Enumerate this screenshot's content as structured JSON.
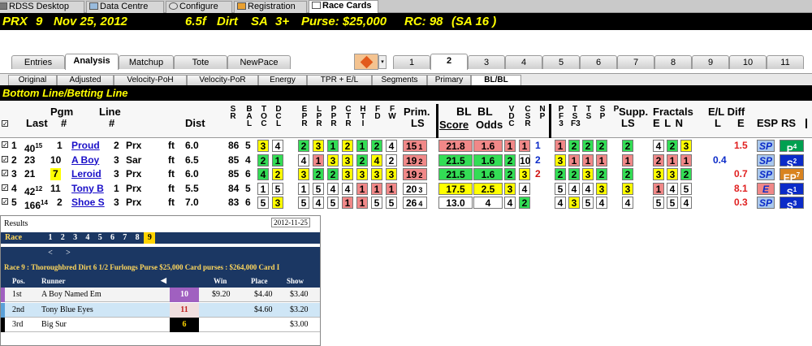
{
  "app_tabs": [
    "RDSS Desktop",
    "Data Centre",
    "Configure",
    "Registration",
    "Race Cards"
  ],
  "race_title": {
    "prx": "PRX",
    "race": "9",
    "date": "Nov 25, 2012",
    "distance": "6.5f",
    "surface": "Dirt",
    "track": "SA",
    "age": "3+",
    "purse": "Purse: $25,000",
    "rc": "RC: 98",
    "rc_sub": "(SA 16 )"
  },
  "nav_tabs": [
    "Entries",
    "Analysis",
    "Matchup",
    "Tote",
    "NewPace"
  ],
  "race_numbers": [
    "1",
    "2",
    "3",
    "4",
    "5",
    "6",
    "7",
    "8",
    "9",
    "10",
    "11"
  ],
  "sub_tabs": [
    "Original",
    "Adjusted",
    "Velocity-PoH",
    "Velocity-PoR",
    "Energy",
    "TPR + E/L",
    "Segments",
    "Primary",
    "BL/BL"
  ],
  "section_title": "Bottom Line/Betting Line",
  "headers": {
    "last": "Last",
    "pgm": "Pgm",
    "pgm2": "#",
    "line": "Line",
    "line2": "#",
    "dist": "Dist",
    "prim": "Prim.",
    "prim2": "LS",
    "bl1": "BL",
    "bl2": "BL",
    "score": "Score",
    "odds": "Odds",
    "supp": "Supp.",
    "supp2": "LS",
    "fractals": "Fractals",
    "eln": "E L N",
    "eldiff": "E/L Diff",
    "l": "L",
    "e": "E",
    "esp": "ESP",
    "rs": "RS",
    "sr": "S\nR",
    "balt": "B\nA\nL",
    "toct": "T\nO\nC",
    "dctl": "D\nC\nL",
    "epp": "E\nP\nR",
    "lpp": "L\nP\nR",
    "ppp": "P\nP\nR",
    "ctr": "C\nT\nR",
    "ht": "H\nT\nI",
    "fd": "F\nD",
    "fwx": "F\nW",
    "vdc": "V\nD\nC",
    "csr": "C\nS\nR",
    "np": "N\nP",
    "pf": "P\nF\n3",
    "ts": "T\nS\nF3",
    "ss": "T\nS",
    "tp": "S\nP",
    "pp": "P"
  },
  "entries": [
    {
      "n": "1",
      "last": "40",
      "last_sup": "15",
      "pgm": "1",
      "name": "Proud",
      "line": "2",
      "trk": "Prx",
      "surf": "ft",
      "dist": "6.0",
      "sr": "86",
      "b": "5",
      "toct": "3",
      "dctl": "4",
      "e1": "2",
      "e2": "3",
      "e3": "1",
      "e4": "2",
      "e5": "1",
      "e6": "2",
      "e7": "4",
      "prim": "15",
      "prim_sup": "1",
      "score": "21.8",
      "odds": "1.6",
      "vdc": "1",
      "csr": "1",
      "np": "1",
      "p1": "1",
      "p2": "2",
      "p3": "2",
      "p4": "2",
      "supp": "2",
      "f1": "4",
      "f2": "2",
      "f3": "3",
      "eld_l": "",
      "eld_e": "1.5",
      "esp": "SP",
      "rs": "P",
      "rs_sup": "4"
    },
    {
      "n": "2",
      "last": "23",
      "last_sup": "",
      "pgm": "10",
      "name": "A Boy",
      "line": "3",
      "trk": "Sar",
      "surf": "ft",
      "dist": "6.5",
      "sr": "85",
      "b": "4",
      "toct": "2",
      "dctl": "1",
      "e1": "4",
      "e2": "1",
      "e3": "3",
      "e4": "3",
      "e5": "2",
      "e6": "4",
      "e7": "2",
      "prim": "19",
      "prim_sup": "2",
      "score": "21.5",
      "odds": "1.6",
      "vdc": "2",
      "csr": "10",
      "np": "2",
      "p1": "3",
      "p2": "1",
      "p3": "1",
      "p4": "1",
      "supp": "1",
      "f1": "2",
      "f2": "1",
      "f3": "1",
      "eld_l": "0.4",
      "eld_e": "",
      "esp": "SP",
      "rs": "S",
      "rs_sup": "2"
    },
    {
      "n": "3",
      "last": "21",
      "last_sup": "",
      "pgm": "7",
      "name": "Leroid",
      "line": "3",
      "trk": "Prx",
      "surf": "ft",
      "dist": "6.0",
      "sr": "85",
      "b": "6",
      "toct": "4",
      "dctl": "2",
      "e1": "3",
      "e2": "2",
      "e3": "2",
      "e4": "3",
      "e5": "3",
      "e6": "3",
      "e7": "3",
      "prim": "19",
      "prim_sup": "2",
      "score": "21.5",
      "odds": "1.6",
      "vdc": "2",
      "csr": "3",
      "np": "2",
      "p1": "2",
      "p2": "2",
      "p3": "3",
      "p4": "2",
      "supp": "2",
      "f1": "3",
      "f2": "3",
      "f3": "2",
      "eld_l": "",
      "eld_e": "0.7",
      "esp": "SP",
      "rs": "EP",
      "rs_sup": "7"
    },
    {
      "n": "4",
      "last": "42",
      "last_sup": "12",
      "pgm": "11",
      "name": "Tony B",
      "line": "1",
      "trk": "Prx",
      "surf": "ft",
      "dist": "5.5",
      "sr": "84",
      "b": "5",
      "toct": "1",
      "dctl": "5",
      "e1": "1",
      "e2": "5",
      "e3": "4",
      "e4": "4",
      "e5": "1",
      "e6": "1",
      "e7": "1",
      "prim": "20",
      "prim_sup": "3",
      "score": "17.5",
      "odds": "2.5",
      "vdc": "3",
      "csr": "4",
      "np": "",
      "p1": "5",
      "p2": "4",
      "p3": "4",
      "p4": "3",
      "supp": "3",
      "f1": "1",
      "f2": "4",
      "f3": "5",
      "eld_l": "",
      "eld_e": "8.1",
      "esp": "E",
      "rs": "S",
      "rs_sup": "1"
    },
    {
      "n": "5",
      "last": "166",
      "last_sup": "14",
      "pgm": "2",
      "name": "Shoe S",
      "line": "3",
      "trk": "Prx",
      "surf": "ft",
      "dist": "7.0",
      "sr": "83",
      "b": "6",
      "toct": "5",
      "dctl": "3",
      "e1": "5",
      "e2": "4",
      "e3": "5",
      "e4": "1",
      "e5": "1",
      "e6": "5",
      "e7": "5",
      "prim": "26",
      "prim_sup": "4",
      "score": "13.0",
      "odds": "4",
      "vdc": "4",
      "csr": "2",
      "np": "",
      "p1": "4",
      "p2": "3",
      "p3": "5",
      "p4": "4",
      "supp": "4",
      "f1": "5",
      "f2": "5",
      "f3": "4",
      "eld_l": "",
      "eld_e": "0.3",
      "esp": "SP",
      "rs": "S",
      "rs_sup": "3"
    }
  ],
  "results": {
    "title": "Results",
    "date": "2012-11-25",
    "race_label": "Race",
    "races": [
      "1",
      "2",
      "3",
      "4",
      "5",
      "6",
      "7",
      "8",
      "9"
    ],
    "prev": "<",
    "next": ">",
    "info": "Race 9 :  Thoroughbred   Dirt   6 1/2 Furlongs   Purse $25,000   Card purses : $264,000   Card I",
    "cols": [
      "Pos.",
      "Runner",
      "Win",
      "Place",
      "Show"
    ],
    "rows": [
      {
        "pos": "1st",
        "runner": "A Boy Named Em",
        "num": "10",
        "win": "$9.20",
        "place": "$4.40",
        "show": "$3.40"
      },
      {
        "pos": "2nd",
        "runner": "Tony Blue Eyes",
        "num": "11",
        "win": "",
        "place": "$4.60",
        "show": "$3.20"
      },
      {
        "pos": "3rd",
        "runner": "Big Sur",
        "num": "6",
        "win": "",
        "place": "",
        "show": "$3.00"
      }
    ]
  },
  "colors": {
    "yellow": "#ffff00",
    "green": "#33dd55",
    "red": "#f08888",
    "navy": "#1b3763",
    "blue": "#0b2bc8"
  }
}
